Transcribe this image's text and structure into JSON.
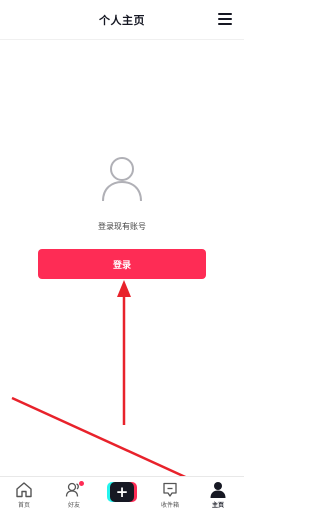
{
  "header": {
    "title": "个人主页",
    "menu_icon": "hamburger-menu-icon"
  },
  "profile": {
    "avatar_icon": "user-outline-icon",
    "prompt": "登录现有账号",
    "login_button": "登录"
  },
  "tabbar": {
    "tabs": [
      {
        "label": "首页",
        "icon": "home-icon",
        "active": false
      },
      {
        "label": "好友",
        "icon": "friends-icon",
        "active": false,
        "badge": true
      },
      {
        "label": "",
        "icon": "plus-icon",
        "active": false
      },
      {
        "label": "收件箱",
        "icon": "inbox-icon",
        "active": false
      },
      {
        "label": "主页",
        "icon": "profile-icon",
        "active": true
      }
    ]
  },
  "colors": {
    "accent": "#fe2c55",
    "cyan": "#25f4ee",
    "dark": "#161823",
    "annotation_arrow": "#e8222b"
  }
}
